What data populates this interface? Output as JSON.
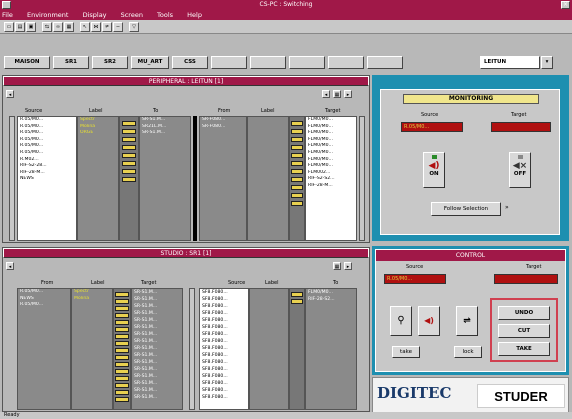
{
  "window": {
    "title": "CS-PC : Switching",
    "close": "×"
  },
  "menu": [
    "File",
    "Environment",
    "Display",
    "Screen",
    "Tools",
    "Help"
  ],
  "groups": {
    "buttons": [
      "MAISON",
      "SR1",
      "SR2",
      "MU_ART",
      "CSS",
      "",
      "",
      "",
      "",
      ""
    ],
    "selector_value": "LEITUN",
    "selector_arrow": "▾"
  },
  "peripheral": {
    "title": "PERIPHERAL : LEITUN [1]",
    "headers": {
      "source": "Source",
      "label": "Label",
      "to": "To",
      "from": "From",
      "label2": "Label",
      "target": "Target"
    },
    "sources": [
      "R.05/M0...",
      "R.05/M0...",
      "R.05/M0...",
      "R.05/M0...",
      "R.05/M0...",
      "R.05/M0...",
      "R.M02...",
      "RIF-S2-28...",
      "RIF-28-M...",
      "NEWS"
    ],
    "labels": [
      "",
      "Spectr",
      "",
      "",
      "Molina",
      "ORGE",
      "",
      "",
      "",
      ""
    ],
    "to": [
      "SR-S1.M...",
      "SR21L.M...",
      "",
      "",
      "",
      "",
      "",
      "",
      "SR-S1.M..."
    ],
    "from": [
      "SR-F080...",
      "",
      "",
      "",
      "",
      "",
      "SR-F080...",
      "",
      ""
    ],
    "targets": [
      "FLM0/M0...",
      "FLM0/M0...",
      "FLM0/M0...",
      "FLM0/M0...",
      "FLM0/M0...",
      "FLM0/M0...",
      "FLM0/M0...",
      "FLM0/M0...",
      "FLM002...",
      "RIF-S2-S2...",
      "RIF-28-M..."
    ]
  },
  "studio": {
    "title": "STUDIO : SR1 [1]",
    "headers": {
      "from": "From",
      "label": "Label",
      "target": "Target",
      "source": "Source",
      "label2": "Label",
      "to": "To"
    },
    "from": [
      "R.05/M0...",
      "",
      "",
      "",
      "",
      "",
      "",
      "",
      "",
      "NEWS",
      "R.05/M0..."
    ],
    "labels": [
      "Spectr",
      "",
      "",
      "",
      "",
      "",
      "",
      "",
      "",
      "",
      "Molina"
    ],
    "targets": [
      "SR-S1.M...",
      "SR-S1.M...",
      "SR-S1.M...",
      "SR-S1.M...",
      "SR-S1.M...",
      "SR-S1.M...",
      "SR-S1.M...",
      "SR-S1.M...",
      "SR-S1.M...",
      "SR-S1.M...",
      "SR-S1.M...",
      "SR-S1.M...",
      "SR-S1.M...",
      "SR-S1.M...",
      "SR-S1.M...",
      "SR-S1.M..."
    ],
    "sources": [
      "SF8.F080...",
      "SF8.F080...",
      "SF8.F080...",
      "SF8.F080...",
      "SF8.F080...",
      "SF8.F080...",
      "SF8.F080...",
      "SF8.F080...",
      "SF8.F080...",
      "SF8.F080...",
      "SF8.F080...",
      "SF8.F080...",
      "SF8.F080...",
      "SF8.F080...",
      "SF8.F080...",
      "SF8.F080..."
    ],
    "to": [
      "FLM0/M0...",
      "RIF-28-S2..."
    ]
  },
  "monitoring": {
    "title": "MONITORING",
    "source_label": "Source",
    "target_label": "Target",
    "source_value": "R.05/M0...",
    "target_value": "",
    "on_label": "ON",
    "off_label": "OFF",
    "follow_label": "Follow Selection",
    "follow_arrow": "»"
  },
  "control": {
    "title": "CONTROL",
    "source_label": "Source",
    "target_label": "Target",
    "source_value": "R.05/M0...",
    "target_value": "",
    "undo": "UNDO",
    "cut": "CUT",
    "take": "TAKE",
    "take_btn": "take",
    "lock_btn": "lock"
  },
  "logos": {
    "left": "DIGITEC",
    "right": "STUDER"
  },
  "status": "Ready",
  "colors": {
    "title_bar": "#a01848",
    "panel_accent": "#1e8fb0",
    "field_red": "#b01010",
    "jack_yellow": "#e8d050"
  }
}
